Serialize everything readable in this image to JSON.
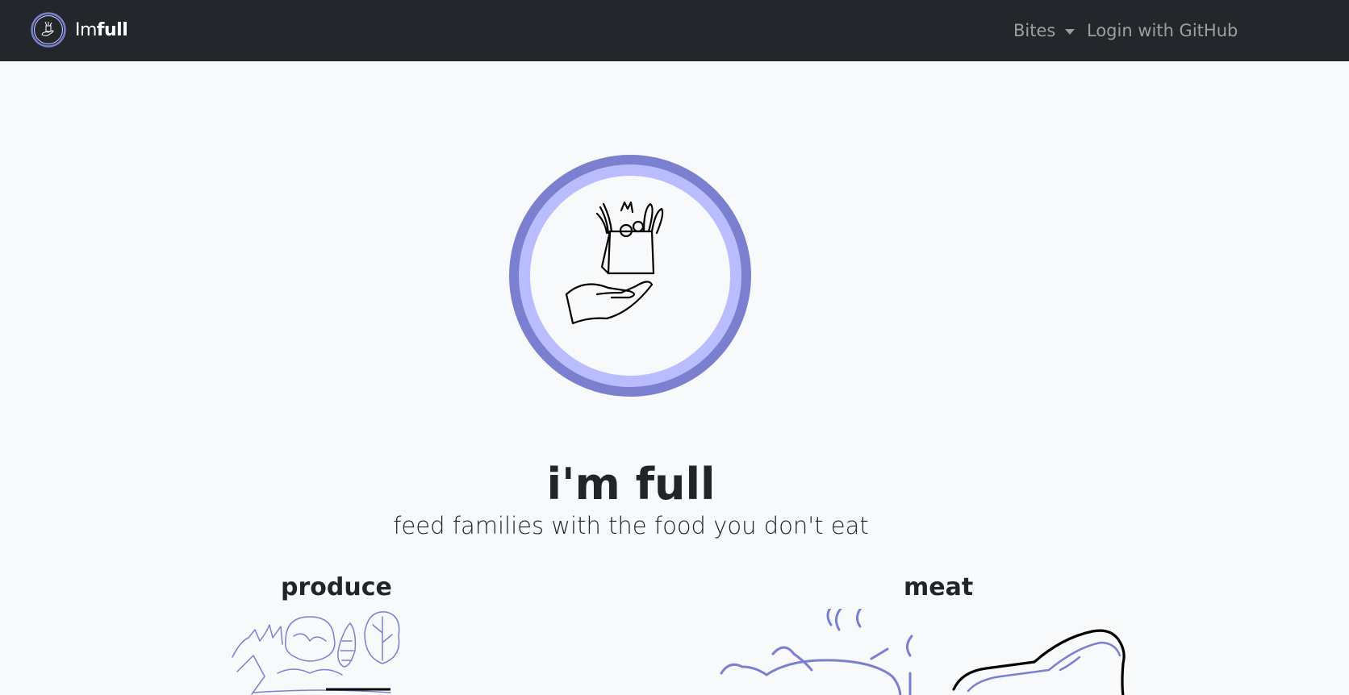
{
  "navbar": {
    "brand_prefix": "Im",
    "brand_bold": "full",
    "bites_label": "Bites",
    "login_label": "Login with GitHub",
    "brand_logo_icon": "hand-grocery-bag-icon"
  },
  "hero": {
    "logo_icon": "hand-grocery-bag-icon",
    "title": "i'm full",
    "subtitle": "feed families with the food you don't eat"
  },
  "categories": [
    {
      "label": "produce",
      "icon": "vegetables-icon"
    },
    {
      "label": "meat",
      "icon": "roast-chicken-steak-icon"
    }
  ],
  "colors": {
    "navbar_bg": "#23272b",
    "page_bg": "#f8f9fb",
    "ring_outer": "#7a80cf",
    "ring_inner": "#b9bdff",
    "illustration": "#7a80cf"
  }
}
